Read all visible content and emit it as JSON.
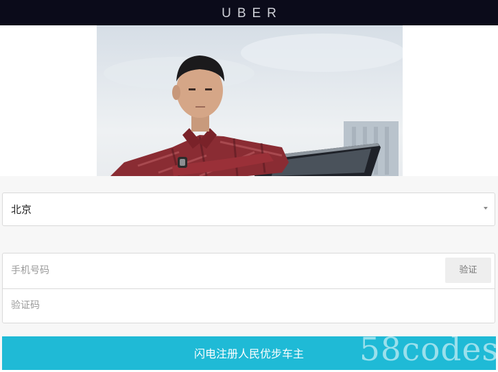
{
  "header": {
    "logo": "UBER",
    "background": "#0b0b1a"
  },
  "hero": {
    "image": "man-leaning-on-car-photo"
  },
  "form": {
    "city": {
      "value": "北京",
      "icon": "dropdown-caret-icon"
    },
    "phone": {
      "placeholder": "手机号码",
      "verify_label": "验证"
    },
    "code": {
      "placeholder": "验证码"
    },
    "submit_label": "闪电注册人民优步车主",
    "accent": "#1fbad6"
  },
  "watermark": "58codes"
}
